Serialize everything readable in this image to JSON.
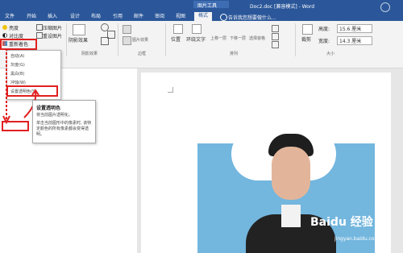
{
  "window": {
    "title": "Doc2.doc [兼容模式] - Word",
    "context_tab_group": "图片工具"
  },
  "tabs": [
    "文件",
    "开始",
    "插入",
    "设计",
    "布局",
    "引用",
    "邮件",
    "审阅",
    "视图",
    "格式"
  ],
  "active_tab": "格式",
  "search": {
    "placeholder": "告诉我您想要做什么..."
  },
  "ribbon": {
    "adjust": {
      "brightness": "亮度",
      "contrast": "对比度",
      "recolor": "重新着色",
      "compress": "压缩图片",
      "reset": "重设图片"
    },
    "shadow": {
      "shadow_effect": "阴影效果",
      "group_label": "阴影效果"
    },
    "border": {
      "group_label": "边框",
      "picture_effect": "图片效果"
    },
    "arrange": {
      "position": "位置",
      "wrap": "环绕文字",
      "forward": "上移一层",
      "backward": "下移一层",
      "selection": "选择窗格",
      "group_label": "排列"
    },
    "size": {
      "crop": "裁剪",
      "height_label": "高度:",
      "height_value": "15.6 厘米",
      "width_label": "宽度:",
      "width_value": "14.3 厘米",
      "group_label": "大小"
    }
  },
  "recolor_menu": {
    "items": [
      "自动(A)",
      "灰度(G)",
      "黑白(B)",
      "冲蚀(W)",
      "设置透明色(S)"
    ]
  },
  "tooltip": {
    "title": "设置透明色",
    "line1": "将当前图片透明化。",
    "body": "单击当前图形中的像素时, 该特定颜色的所有像素都会变得透明。"
  },
  "watermark": {
    "brand": "Baidu 经验",
    "url": "jingyan.baidu.com"
  },
  "colors": {
    "word_blue": "#2b579a",
    "highlight_red": "#e02020",
    "photo_bg": "#5aa9d8"
  }
}
